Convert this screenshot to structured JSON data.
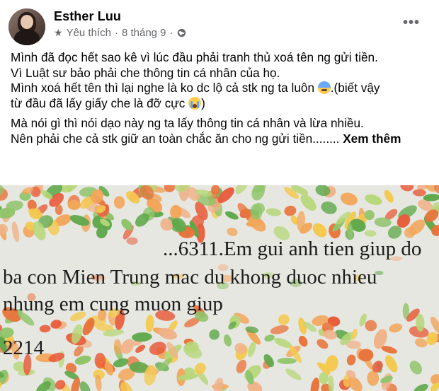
{
  "author": {
    "name": "Esther Luu"
  },
  "meta": {
    "favorite_label": "Yêu thích",
    "separator": "·",
    "date": "8 tháng 9",
    "icons": [
      "star-icon",
      "globe-icon"
    ]
  },
  "menu": {
    "more_label": "•••"
  },
  "post": {
    "para1": {
      "line1": "Mình đã đọc hết sao kê vì lúc đầu phải tranh thủ xoá tên ng gửi tiền.",
      "line2": "Vì Luật sư bảo phải che thông tin cá nhân của họ.",
      "line3a": "Mình xoá hết tên thì lại nghe là ko dc lộ cả stk ng ta luôn ",
      "line3b": ".(biết vậy",
      "line4a": "từ đầu đã lấy giấy che là đỡ cực "
    },
    "para2": {
      "line1": "Mà nói gì thì nói dạo này ng ta lấy thông tin cá nhân và lừa nhiều.",
      "line2": "Nên phải che cả stk giữ an toàn chắc ăn cho ng gửi tiền........ ",
      "see_more": "Xem thêm"
    }
  },
  "photo": {
    "line1": "...6311.Em gui anh tien giup do",
    "line2": "ba con Mien Trung mac du khong duoc nhieu",
    "line3": "nhung em cung muon giup",
    "line4": "2214"
  },
  "colors": {
    "text": "#050505",
    "meta": "#65676b",
    "leaf_palette": [
      "#e8743b",
      "#f2a65a",
      "#8fc46a",
      "#5fa84a",
      "#f3c94f",
      "#e85d3c",
      "#b7d77a",
      "#f0b38a"
    ]
  }
}
